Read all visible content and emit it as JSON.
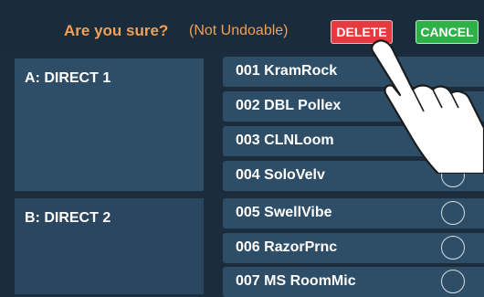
{
  "dialog": {
    "prompt": "Are you sure?",
    "note": "(Not Undoable)",
    "delete_label": "DELETE",
    "cancel_label": "CANCEL",
    "colors": {
      "prompt": "#f0a057",
      "delete": "#e63a40",
      "cancel": "#2fb14a"
    }
  },
  "banks": [
    {
      "label": "A: DIRECT 1"
    },
    {
      "label": "B: DIRECT 2"
    }
  ],
  "patches": [
    {
      "label": "001 KramRock",
      "checkbox": false
    },
    {
      "label": "002 DBL Pollex",
      "checkbox": false
    },
    {
      "label": "003 CLNLoom",
      "checkbox": false
    },
    {
      "label": "004 SoloVelv",
      "checkbox": true
    },
    {
      "label": "005 SwellVibe",
      "checkbox": true
    },
    {
      "label": "006 RazorPrnc",
      "checkbox": true
    },
    {
      "label": "007 MS RoomMic",
      "checkbox": true
    }
  ],
  "overlay": {
    "icon": "pointing-hand-icon"
  }
}
